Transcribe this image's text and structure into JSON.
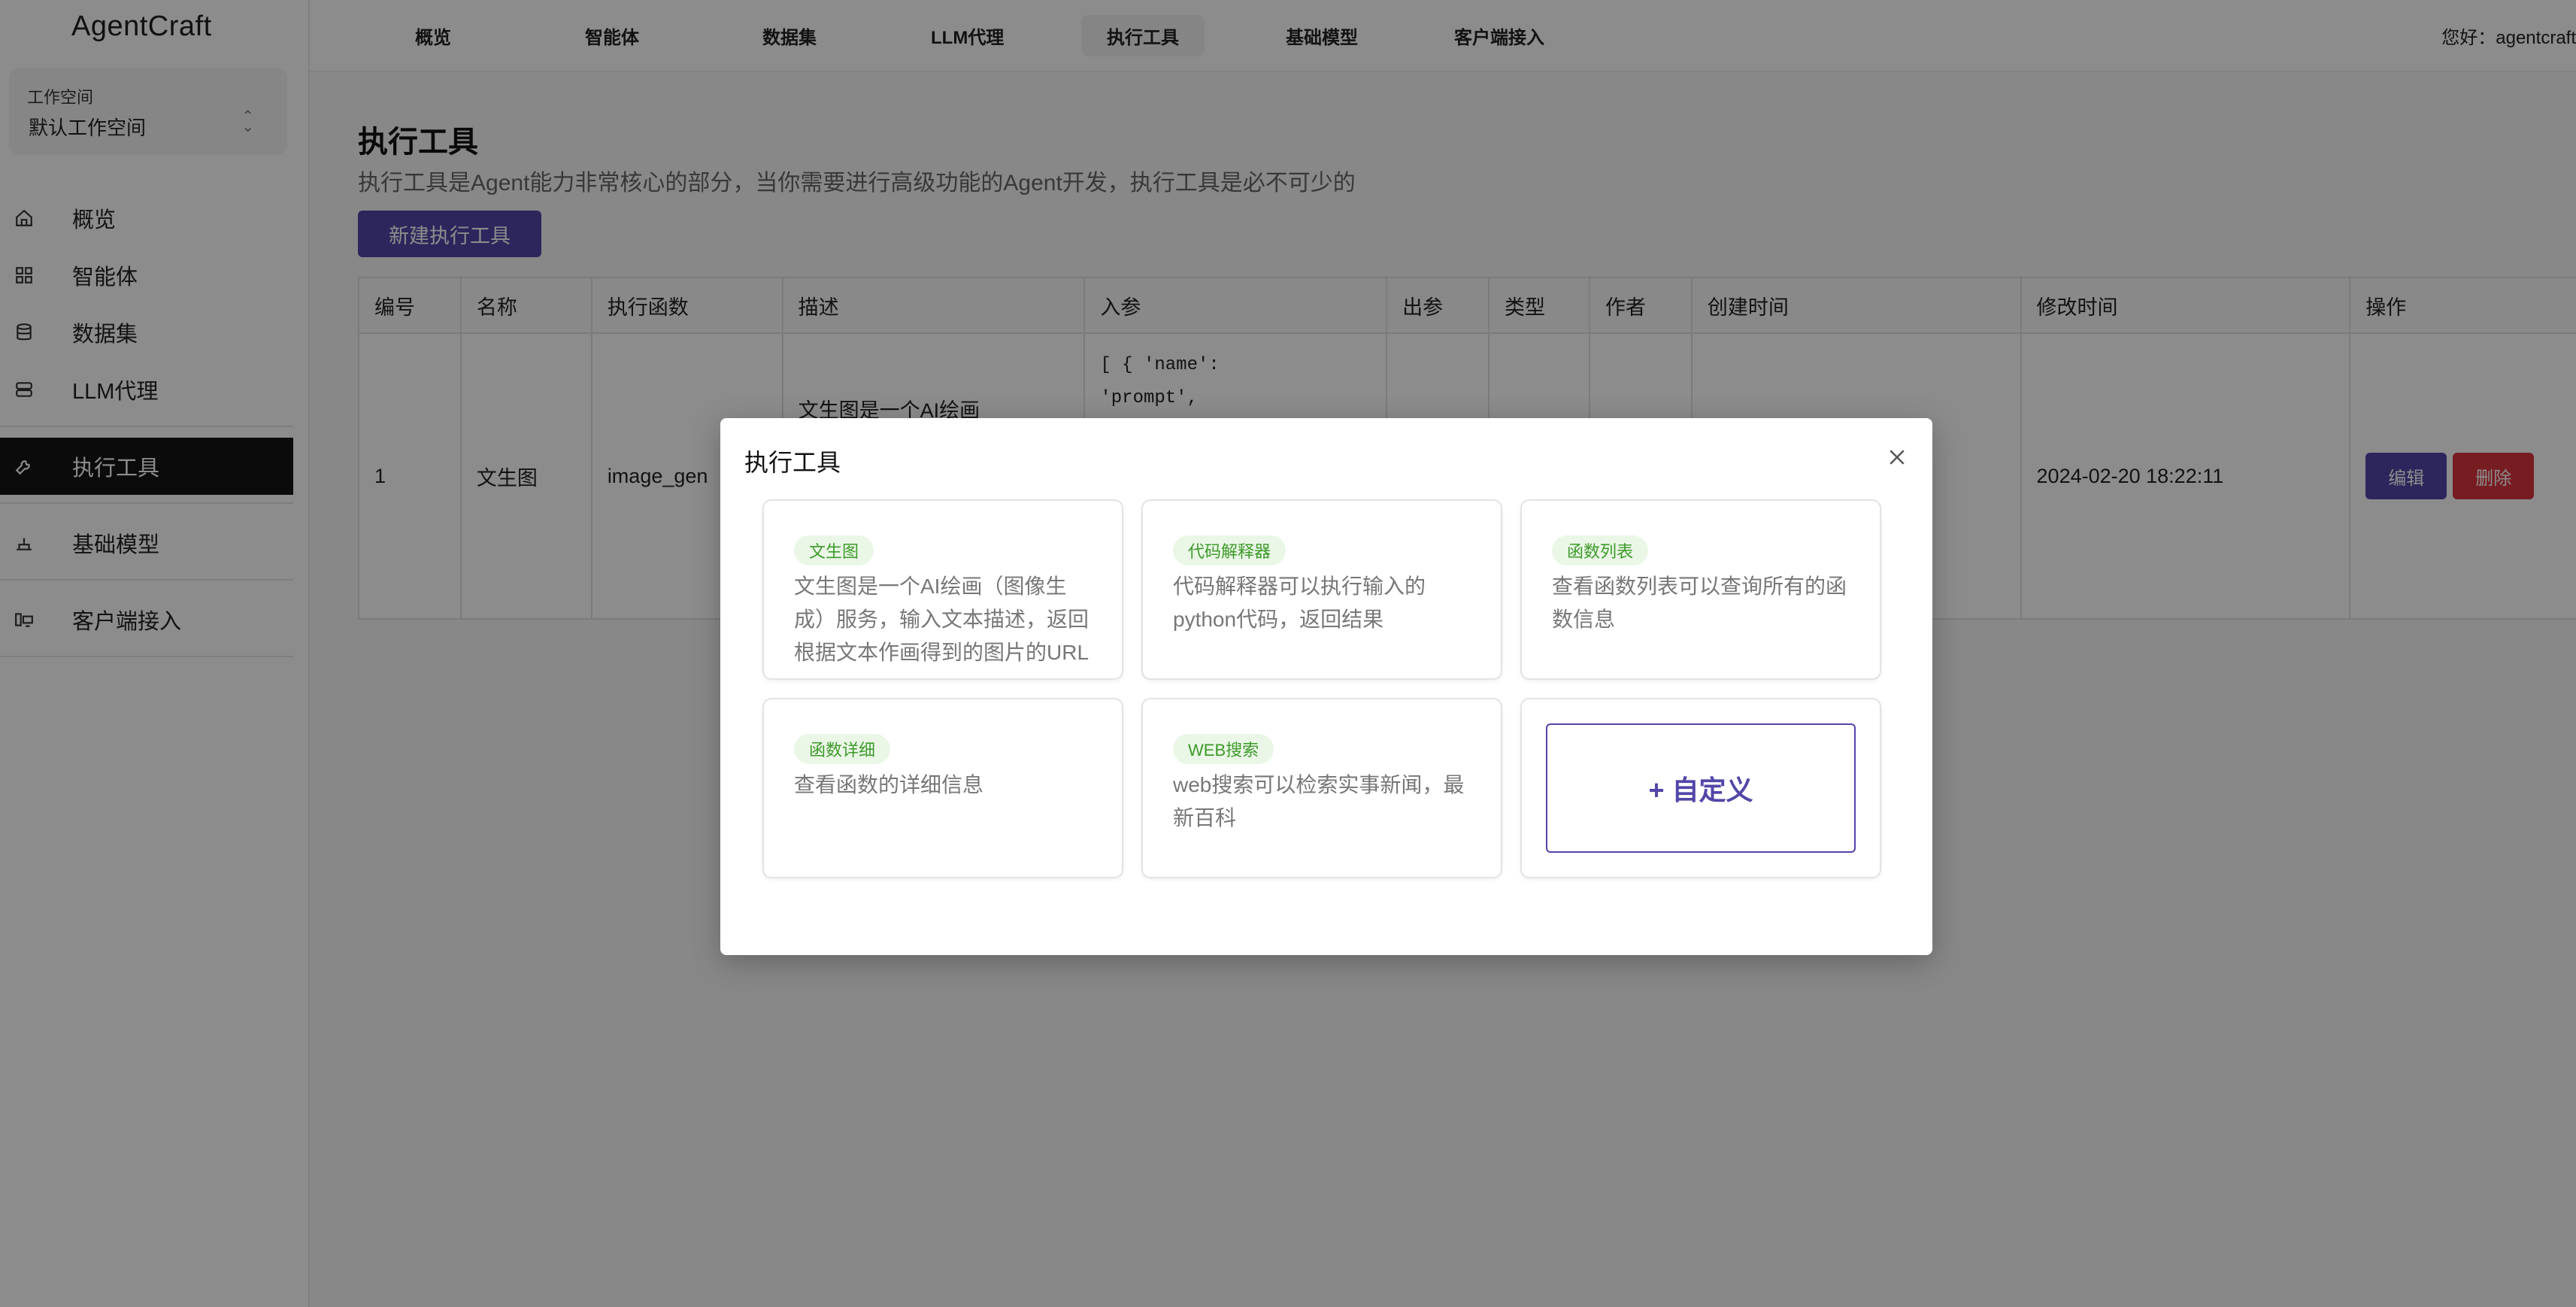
{
  "app": {
    "brand": "AgentCraft"
  },
  "workspace": {
    "label": "工作空间",
    "value": "默认工作空间"
  },
  "sidebar": {
    "items": [
      {
        "label": "概览",
        "icon": "home-icon"
      },
      {
        "label": "智能体",
        "icon": "apps-icon"
      },
      {
        "label": "数据集",
        "icon": "database-icon"
      },
      {
        "label": "LLM代理",
        "icon": "server-icon"
      },
      {
        "label": "执行工具",
        "icon": "tool-icon",
        "active": true
      },
      {
        "label": "基础模型",
        "icon": "scale-icon"
      },
      {
        "label": "客户端接入",
        "icon": "device-icon"
      }
    ]
  },
  "topnav": {
    "tabs": [
      {
        "label": "概览"
      },
      {
        "label": "智能体"
      },
      {
        "label": "数据集"
      },
      {
        "label": "LLM代理"
      },
      {
        "label": "执行工具",
        "active": true
      },
      {
        "label": "基础模型"
      },
      {
        "label": "客户端接入"
      }
    ],
    "greeting": "您好：agentcraft"
  },
  "page": {
    "title": "执行工具",
    "description": "执行工具是Agent能力非常核心的部分，当你需要进行高级功能的Agent开发，执行工具是必不可少的",
    "new_button": "新建执行工具"
  },
  "table": {
    "headers": [
      "编号",
      "名称",
      "执行函数",
      "描述",
      "入参",
      "出参",
      "类型",
      "作者",
      "创建时间",
      "修改时间",
      "操作"
    ],
    "rows": [
      {
        "id": "1",
        "name": "文生图",
        "func": "image_gen",
        "desc": "文生图是一个AI绘画",
        "params_line1": "[ { 'name':",
        "params_line2": "'prompt',",
        "output": "",
        "type": "",
        "author": "",
        "created": "",
        "modified": "2024-02-20 18:22:11",
        "edit": "编辑",
        "delete": "删除"
      }
    ]
  },
  "modal": {
    "title": "执行工具",
    "cards": [
      {
        "tag": "文生图",
        "desc": "文生图是一个AI绘画（图像生成）服务，输入文本描述，返回根据文本作画得到的图片的URL"
      },
      {
        "tag": "代码解释器",
        "desc": "代码解释器可以执行输入的python代码，返回结果"
      },
      {
        "tag": "函数列表",
        "desc": "查看函数列表可以查询所有的函数信息"
      },
      {
        "tag": "函数详细",
        "desc": "查看函数的详细信息"
      },
      {
        "tag": "WEB搜索",
        "desc": "web搜索可以检索实事新闻，最新百科"
      }
    ],
    "custom_label": "+ 自定义"
  },
  "colors": {
    "primary": "#5146a8",
    "danger": "#d9363e",
    "tag_bg": "#eaf7e6",
    "tag_text": "#3d9a2a"
  }
}
